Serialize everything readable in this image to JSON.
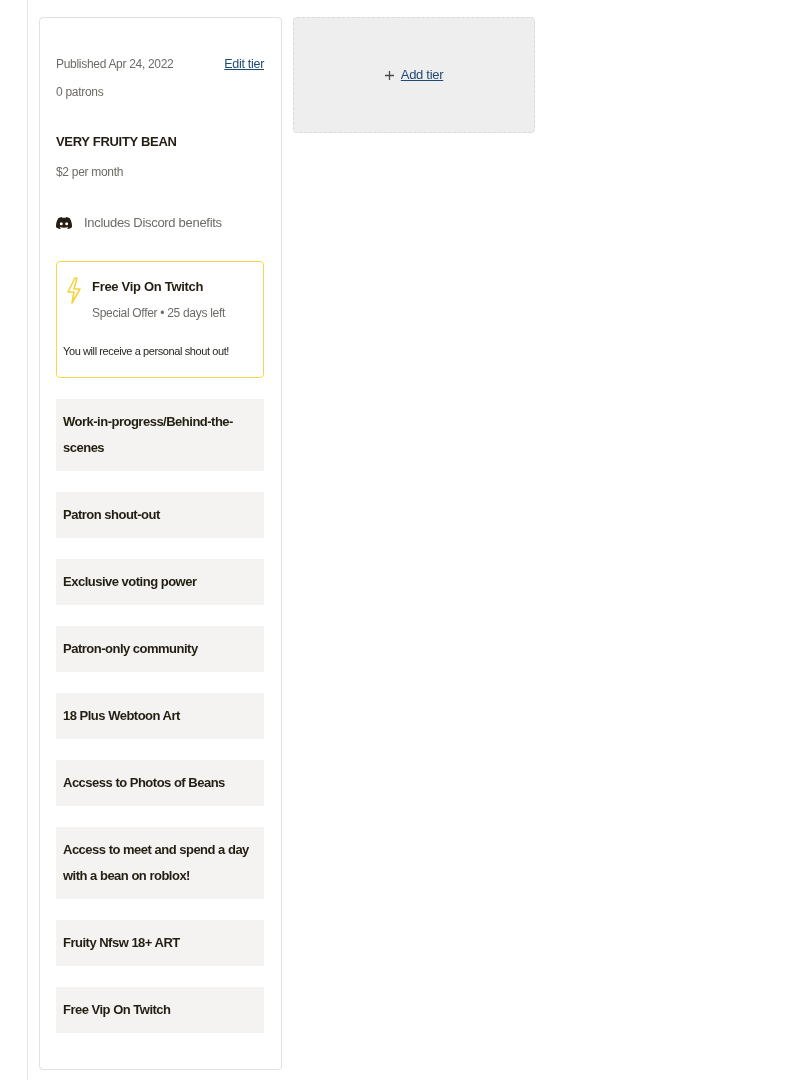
{
  "tier": {
    "published": "Published Apr 24, 2022",
    "patrons": "0 patrons",
    "edit_link": "Edit tier",
    "title": "VERY FRUITY BEAN",
    "price": "$2 per month",
    "discord": {
      "label": "Includes Discord benefits"
    },
    "special_offer": {
      "title": "Free Vip On Twitch",
      "meta": "Special Offer • 25 days left",
      "description": "You will receive a personal shout out!"
    },
    "benefits": [
      "Work-in-progress/Behind-the-scenes",
      "Patron shout-out",
      "Exclusive voting power",
      "Patron-only community",
      "18 Plus Webtoon Art",
      "Accsess to Photos of Beans",
      "Access to meet and spend a day with a bean on roblox!",
      "Fruity Nfsw 18+ ART",
      "Free Vip On Twitch"
    ]
  },
  "add_tier": {
    "label": "Add tier"
  }
}
